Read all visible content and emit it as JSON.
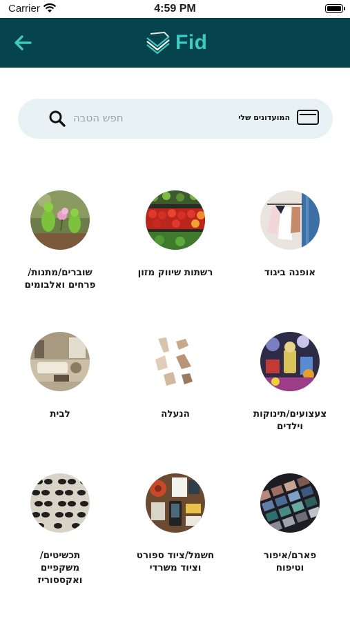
{
  "status_bar": {
    "carrier": "Carrier",
    "time": "4:59 PM"
  },
  "header": {
    "logo_text": "Fid",
    "brand_color": "#05434d",
    "accent_color": "#3ec8c0"
  },
  "search": {
    "placeholder": "חפש הטבה",
    "my_clubs_label": "המועדונים שלי"
  },
  "categories": [
    {
      "label": "אופנה ביגוד",
      "icon": "clothing-rack-photo"
    },
    {
      "label": "רשתות שיווק מזון",
      "icon": "produce-market-photo"
    },
    {
      "label": "שוברים/מתנות/\nפרחים ואלבומים",
      "icon": "gift-frogs-photo"
    },
    {
      "label": "צעצועים/תינוקות\nוילדים",
      "icon": "toys-photo"
    },
    {
      "label": "הנעלה",
      "icon": "shoes-photo"
    },
    {
      "label": "לבית",
      "icon": "living-room-photo"
    },
    {
      "label": "פארם/איפור\nוטיפוח",
      "icon": "makeup-palette-photo"
    },
    {
      "label": "חשמל/ציוד ספורט\nוציוד משרדי",
      "icon": "office-gadgets-photo"
    },
    {
      "label": "תכשיטים/\nמשקפיים\nואקססוריז",
      "icon": "sunglasses-photo"
    }
  ]
}
